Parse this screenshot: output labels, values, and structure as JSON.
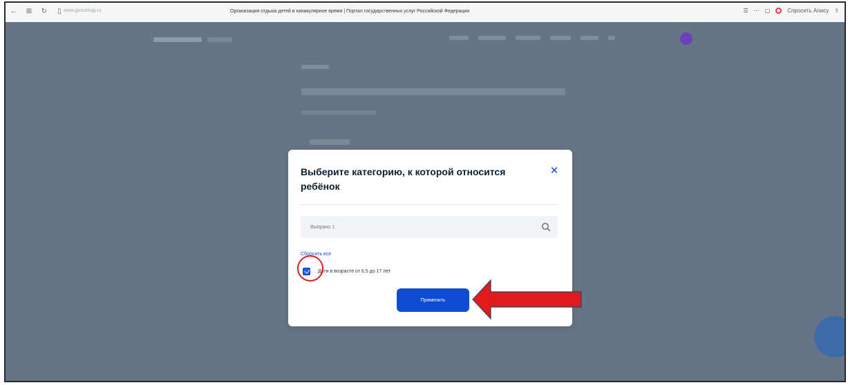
{
  "browser": {
    "url": "www.gosuslugi.ru",
    "tab_title": "Организация отдыха детей в каникулярное время | Портал государственных услуг Российской Федерации",
    "alice_label": "Спросить Алису"
  },
  "modal": {
    "title": "Выберите категорию, к которой относится ребёнок",
    "search_placeholder": "Выбрано 1",
    "reset_label": "Сбросить все",
    "option_label": "Дети в возрасте от 6,5 до 17 лет",
    "option_checked": true,
    "apply_label": "Применить"
  },
  "icons": {
    "close": "close-icon",
    "search": "search-icon"
  },
  "colors": {
    "accent": "#0d4cd3",
    "overlay": "#667585",
    "annotation": "#e31a1c"
  }
}
